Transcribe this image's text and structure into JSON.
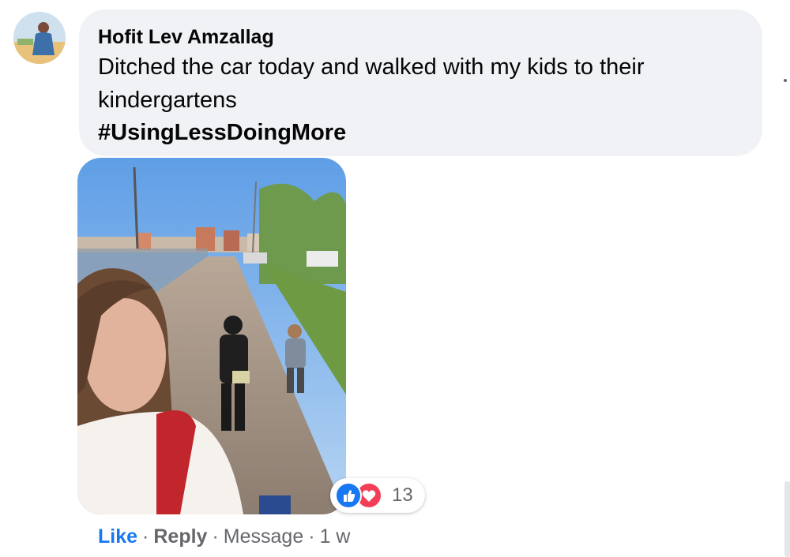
{
  "comment": {
    "author": "Hofit Lev Amzallag",
    "text": "Ditched the car today and walked with my kids to their kindergartens",
    "hashtag": "#UsingLessDoingMore"
  },
  "reactions": {
    "icons": [
      "like-icon",
      "love-icon"
    ],
    "count": "13",
    "colors": {
      "like": "#1877f2",
      "love": "#f33e58"
    }
  },
  "actions": {
    "like": "Like",
    "reply": "Reply",
    "message": "Message",
    "separator": "·",
    "time": "1 w"
  },
  "colors": {
    "bubble": "#f0f2f5",
    "secondary_text": "#65676b",
    "primary_text": "#050505"
  }
}
